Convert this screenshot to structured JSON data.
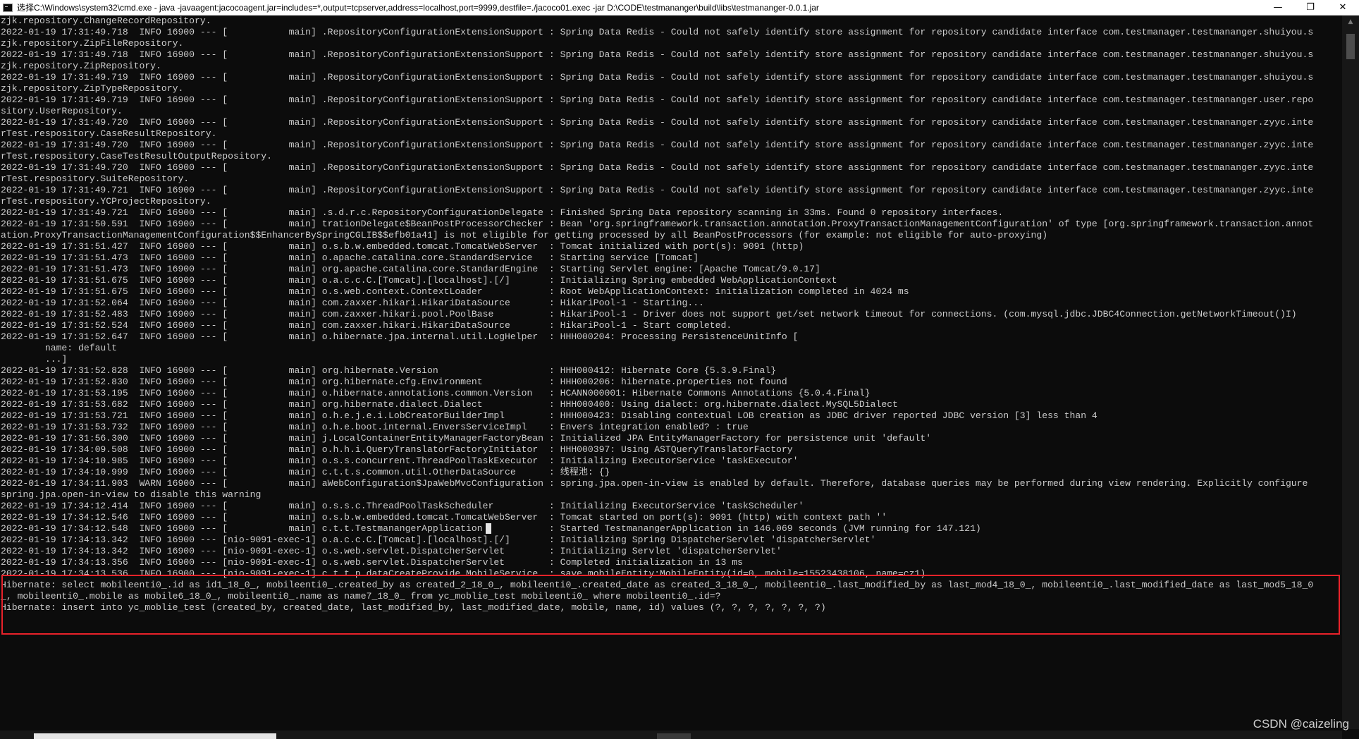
{
  "window": {
    "title": "选择C:\\Windows\\system32\\cmd.exe - java  -javaagent:jacocoagent.jar=includes=*,output=tcpserver,address=localhost,port=9999,destfile=./jacoco01.exec  -jar D:\\CODE\\testmananger\\build\\libs\\testmananger-0.0.1.jar",
    "minimize": "—",
    "maximize": "❐",
    "close": "✕"
  },
  "console": {
    "lines": [
      "zjk.repository.ChangeRecordRepository.",
      "2022-01-19 17:31:49.718  INFO 16900 --- [           main] .RepositoryConfigurationExtensionSupport : Spring Data Redis - Could not safely identify store assignment for repository candidate interface com.testmanager.testmananger.shuiyou.s",
      "zjk.repository.ZipFileRepository.",
      "2022-01-19 17:31:49.718  INFO 16900 --- [           main] .RepositoryConfigurationExtensionSupport : Spring Data Redis - Could not safely identify store assignment for repository candidate interface com.testmanager.testmananger.shuiyou.s",
      "zjk.repository.ZipRepository.",
      "2022-01-19 17:31:49.719  INFO 16900 --- [           main] .RepositoryConfigurationExtensionSupport : Spring Data Redis - Could not safely identify store assignment for repository candidate interface com.testmanager.testmananger.shuiyou.s",
      "zjk.repository.ZipTypeRepository.",
      "2022-01-19 17:31:49.719  INFO 16900 --- [           main] .RepositoryConfigurationExtensionSupport : Spring Data Redis - Could not safely identify store assignment for repository candidate interface com.testmanager.testmananger.user.repo",
      "sitory.UserRepository.",
      "2022-01-19 17:31:49.720  INFO 16900 --- [           main] .RepositoryConfigurationExtensionSupport : Spring Data Redis - Could not safely identify store assignment for repository candidate interface com.testmanager.testmananger.zyyc.inte",
      "rTest.respository.CaseResultRepository.",
      "2022-01-19 17:31:49.720  INFO 16900 --- [           main] .RepositoryConfigurationExtensionSupport : Spring Data Redis - Could not safely identify store assignment for repository candidate interface com.testmanager.testmananger.zyyc.inte",
      "rTest.respository.CaseTestResultOutputRepository.",
      "2022-01-19 17:31:49.720  INFO 16900 --- [           main] .RepositoryConfigurationExtensionSupport : Spring Data Redis - Could not safely identify store assignment for repository candidate interface com.testmanager.testmananger.zyyc.inte",
      "rTest.respository.SuiteRepository.",
      "2022-01-19 17:31:49.721  INFO 16900 --- [           main] .RepositoryConfigurationExtensionSupport : Spring Data Redis - Could not safely identify store assignment for repository candidate interface com.testmanager.testmananger.zyyc.inte",
      "rTest.respository.YCProjectRepository.",
      "2022-01-19 17:31:49.721  INFO 16900 --- [           main] .s.d.r.c.RepositoryConfigurationDelegate : Finished Spring Data repository scanning in 33ms. Found 0 repository interfaces.",
      "2022-01-19 17:31:50.591  INFO 16900 --- [           main] trationDelegate$BeanPostProcessorChecker : Bean 'org.springframework.transaction.annotation.ProxyTransactionManagementConfiguration' of type [org.springframework.transaction.annot",
      "ation.ProxyTransactionManagementConfiguration$$EnhancerBySpringCGLIB$$efb01a41] is not eligible for getting processed by all BeanPostProcessors (for example: not eligible for auto-proxying)",
      "2022-01-19 17:31:51.427  INFO 16900 --- [           main] o.s.b.w.embedded.tomcat.TomcatWebServer  : Tomcat initialized with port(s): 9091 (http)",
      "2022-01-19 17:31:51.473  INFO 16900 --- [           main] o.apache.catalina.core.StandardService   : Starting service [Tomcat]",
      "2022-01-19 17:31:51.473  INFO 16900 --- [           main] org.apache.catalina.core.StandardEngine  : Starting Servlet engine: [Apache Tomcat/9.0.17]",
      "2022-01-19 17:31:51.675  INFO 16900 --- [           main] o.a.c.c.C.[Tomcat].[localhost].[/]       : Initializing Spring embedded WebApplicationContext",
      "2022-01-19 17:31:51.675  INFO 16900 --- [           main] o.s.web.context.ContextLoader            : Root WebApplicationContext: initialization completed in 4024 ms",
      "2022-01-19 17:31:52.064  INFO 16900 --- [           main] com.zaxxer.hikari.HikariDataSource       : HikariPool-1 - Starting...",
      "2022-01-19 17:31:52.483  INFO 16900 --- [           main] com.zaxxer.hikari.pool.PoolBase          : HikariPool-1 - Driver does not support get/set network timeout for connections. (com.mysql.jdbc.JDBC4Connection.getNetworkTimeout()I)",
      "2022-01-19 17:31:52.524  INFO 16900 --- [           main] com.zaxxer.hikari.HikariDataSource       : HikariPool-1 - Start completed.",
      "2022-01-19 17:31:52.647  INFO 16900 --- [           main] o.hibernate.jpa.internal.util.LogHelper  : HHH000204: Processing PersistenceUnitInfo [",
      "        name: default",
      "        ...]",
      "2022-01-19 17:31:52.828  INFO 16900 --- [           main] org.hibernate.Version                    : HHH000412: Hibernate Core {5.3.9.Final}",
      "2022-01-19 17:31:52.830  INFO 16900 --- [           main] org.hibernate.cfg.Environment            : HHH000206: hibernate.properties not found",
      "2022-01-19 17:31:53.195  INFO 16900 --- [           main] o.hibernate.annotations.common.Version   : HCANN000001: Hibernate Commons Annotations {5.0.4.Final}",
      "2022-01-19 17:31:53.682  INFO 16900 --- [           main] org.hibernate.dialect.Dialect            : HHH000400: Using dialect: org.hibernate.dialect.MySQL5Dialect",
      "2022-01-19 17:31:53.721  INFO 16900 --- [           main] o.h.e.j.e.i.LobCreatorBuilderImpl        : HHH000423: Disabling contextual LOB creation as JDBC driver reported JDBC version [3] less than 4",
      "2022-01-19 17:31:53.732  INFO 16900 --- [           main] o.h.e.boot.internal.EnversServiceImpl    : Envers integration enabled? : true",
      "2022-01-19 17:31:56.300  INFO 16900 --- [           main] j.LocalContainerEntityManagerFactoryBean : Initialized JPA EntityManagerFactory for persistence unit 'default'",
      "2022-01-19 17:34:09.508  INFO 16900 --- [           main] o.h.h.i.QueryTranslatorFactoryInitiator  : HHH000397: Using ASTQueryTranslatorFactory",
      "2022-01-19 17:34:10.985  INFO 16900 --- [           main] o.s.s.concurrent.ThreadPoolTaskExecutor  : Initializing ExecutorService 'taskExecutor'",
      "2022-01-19 17:34:10.999  INFO 16900 --- [           main] c.t.t.s.common.util.OtherDataSource      : 线程池: {}",
      "2022-01-19 17:34:11.903  WARN 16900 --- [           main] aWebConfiguration$JpaWebMvcConfiguration : spring.jpa.open-in-view is enabled by default. Therefore, database queries may be performed during view rendering. Explicitly configure",
      "spring.jpa.open-in-view to disable this warning",
      "2022-01-19 17:34:12.414  INFO 16900 --- [           main] o.s.s.c.ThreadPoolTaskScheduler          : Initializing ExecutorService 'taskScheduler'",
      "2022-01-19 17:34:12.546  INFO 16900 --- [           main] o.s.b.w.embedded.tomcat.TomcatWebServer  : Tomcat started on port(s): 9091 (http) with context path ''",
      "2022-01-19 17:34:12.548  INFO 16900 --- [           main] c.t.t.TestmanangerApplication            : Started TestmanangerApplication in 146.069 seconds (JVM running for 147.121)",
      "2022-01-19 17:34:13.342  INFO 16900 --- [nio-9091-exec-1] o.a.c.c.C.[Tomcat].[localhost].[/]       : Initializing Spring DispatcherServlet 'dispatcherServlet'",
      "2022-01-19 17:34:13.342  INFO 16900 --- [nio-9091-exec-1] o.s.web.servlet.DispatcherServlet        : Initializing Servlet 'dispatcherServlet'",
      "2022-01-19 17:34:13.356  INFO 16900 --- [nio-9091-exec-1] o.s.web.servlet.DispatcherServlet        : Completed initialization in 13 ms",
      "2022-01-19 17:34:13.536  INFO 16900 --- [nio-9091-exec-1] c.t.t.p.dataCreateProvide.MobileService  : save mobileEntity:MobileEntity(id=0, mobile=15523438106, name=cz1)",
      "Hibernate: select mobileenti0_.id as id1_18_0_, mobileenti0_.created_by as created_2_18_0_, mobileenti0_.created_date as created_3_18_0_, mobileenti0_.last_modified_by as last_mod4_18_0_, mobileenti0_.last_modified_date as last_mod5_18_0",
      "_, mobileenti0_.mobile as mobile6_18_0_, mobileenti0_.name as name7_18_0_ from yc_moblie_test mobileenti0_ where mobileenti0_.id=?",
      "Hibernate: insert into yc_moblie_test (created_by, created_date, last_modified_by, last_modified_date, mobile, name, id) values (?, ?, ?, ?, ?, ?, ?)"
    ]
  },
  "watermark": "CSDN @caizeling",
  "colors": {
    "console_bg": "#0c0c0c",
    "console_fg": "#cccccc",
    "highlight": "#e8222a"
  }
}
